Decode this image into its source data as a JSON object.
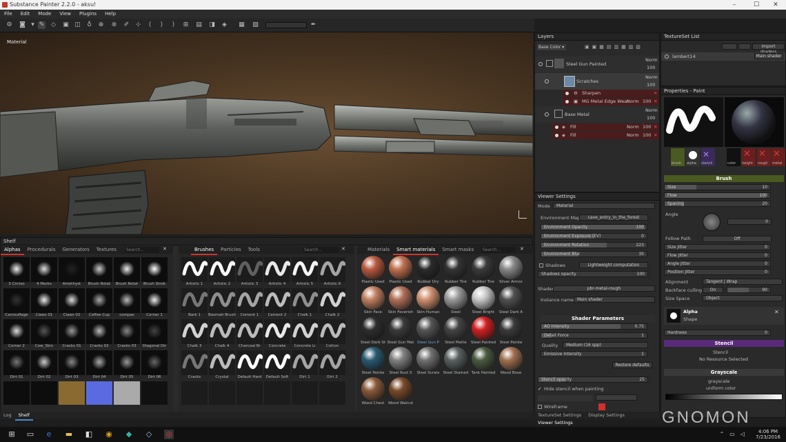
{
  "window": {
    "title": "Substance Painter 2.2.0 - aksu!"
  },
  "menu": [
    "File",
    "Edit",
    "Mode",
    "View",
    "Plugins",
    "Help"
  ],
  "viewport": {
    "label": "Material"
  },
  "layers": {
    "title": "Layers",
    "channel": "Base Color",
    "items": [
      {
        "name": "Steel Gun Painted",
        "blend": "Norm",
        "opacity": "100"
      },
      {
        "name": "Scratches",
        "blend": "Norm",
        "opacity": "100"
      },
      {
        "name": "Sharpen",
        "blend": "",
        "opacity": ""
      },
      {
        "name": "MG Metal Edge Wear",
        "blend": "Norm",
        "opacity": "100"
      },
      {
        "name": "Base Metal",
        "blend": "Norm",
        "opacity": "100"
      },
      {
        "name": "Fill",
        "blend": "Norm",
        "opacity": "100"
      },
      {
        "name": "Fill",
        "blend": "Norm",
        "opacity": "100"
      }
    ]
  },
  "textureset": {
    "title": "TextureSet List",
    "import_button": "Import shaders",
    "item": "lambert14",
    "shader": "Main shader"
  },
  "properties": {
    "title": "Properties - Paint",
    "slots": [
      "brush",
      "alpha",
      "stencil",
      "color",
      "height",
      "rough",
      "metal"
    ],
    "brush_section": "Brush",
    "size": {
      "label": "Size",
      "value": "10"
    },
    "flow": {
      "label": "Flow",
      "value": "100"
    },
    "spacing": {
      "label": "Spacing",
      "value": "20"
    },
    "angle": {
      "label": "Angle",
      "value": "0"
    },
    "follow_path": {
      "label": "Follow Path",
      "value": "Off"
    },
    "jitters": [
      {
        "label": "Size Jitter",
        "value": "0"
      },
      {
        "label": "Flow Jitter",
        "value": "0"
      },
      {
        "label": "Angle Jitter",
        "value": "0"
      },
      {
        "label": "Position Jitter",
        "value": "0"
      }
    ],
    "alignment": {
      "label": "Alignment",
      "value": "Tangent | Wrap"
    },
    "backface": {
      "label": "Backface culling",
      "toggle": "On",
      "value": "90"
    },
    "size_space": {
      "label": "Size Space",
      "value": "Object"
    },
    "alpha_section": "Alpha",
    "alpha_shape": "Shape",
    "hardness": {
      "label": "Hardness",
      "value": "0"
    },
    "stencil_section": "Stencil",
    "stencil_name": "Stencil",
    "stencil_status": "No Resource Selected",
    "grayscale_section": "Grayscale",
    "grayscale_name": "grayscale",
    "grayscale_sub": "uniform color"
  },
  "viewer": {
    "title": "Viewer Settings",
    "mode_label": "Mode",
    "mode": "Material",
    "envmap_label": "Environment Map",
    "envmap": "cave_entry_in_the_forest",
    "sliders": [
      {
        "label": "Environment Opacity",
        "value": "100",
        "fill": 0.98
      },
      {
        "label": "Environment Exposure (EV)",
        "value": "0",
        "fill": 0.5
      },
      {
        "label": "Environment Rotation",
        "value": "223",
        "fill": 0.62
      },
      {
        "label": "Environment Blur",
        "value": "35",
        "fill": 0.35
      }
    ],
    "shadows": "Shadows",
    "shadows_btn": "Lightweight computation",
    "shadows_opacity": {
      "label": "Shadows opacity",
      "value": "100"
    },
    "shader_label": "Shader",
    "shader": "pbr-metal-rough",
    "instance_label": "Instance name",
    "instance": "Main shader",
    "params_section": "Shader Parameters",
    "ao": {
      "label": "AO Intensity",
      "value": "0.75"
    },
    "face": {
      "label": "Detail Force",
      "value": "1"
    },
    "quality_label": "Quality",
    "quality": "Medium (16 spp)",
    "emissive": {
      "label": "Emissive Intensity",
      "value": "1"
    },
    "restore": "Restore defaults",
    "stencil_opacity": {
      "label": "Stencil opacity",
      "value": "25"
    },
    "hide_stencil": "Hide stencil when painting",
    "wireframe": "Wireframe",
    "bottom_tabs": [
      "TextureSet Settings",
      "Display Settings",
      "Viewer Settings"
    ]
  },
  "shelf": {
    "title": "Shelf",
    "tabs": [
      "Alphas",
      "Procedurals",
      "Generators",
      "Textures"
    ],
    "search": "Search...",
    "alphas": [
      "3 Circles",
      "4 Marks",
      "Amethyst",
      "Brush Rotat",
      "Brush Rotat",
      "Brush Strok",
      "Camouflage",
      "Claws 01",
      "Claws 02",
      "Coffee Cup",
      "compas",
      "Corner 1",
      "Corner 2",
      "Cow_Skin",
      "Cracks 01",
      "Cracks 02",
      "Cracks 03",
      "Diagonal Dir",
      "Dirt 01",
      "Dirt 02",
      "Dirt 03",
      "Dirt 04",
      "Dirt 05",
      "Dirt 06"
    ],
    "brush_tabs": [
      "Brushes",
      "Particles",
      "Tools"
    ],
    "brushes": [
      "Artistic 1",
      "Artistic 2",
      "Artistic 3",
      "Artistic 4",
      "Artistic 5",
      "Artistic 6",
      "Bark 1",
      "Basmati Brush",
      "Cement 1",
      "Cement 2",
      "Chalk 1",
      "Chalk 2",
      "Chalk 3",
      "Chalk 4",
      "Charcoal Br",
      "Concrete",
      "Concrete Li",
      "Cotton",
      "Cracks",
      "Crystal",
      "Default Hard",
      "Default Soft",
      "Dirt 1",
      "Dirt 2"
    ],
    "mat_tabs": [
      "Materials",
      "Smart materials",
      "Smart masks"
    ],
    "materials": [
      "Plastic Used",
      "Plastic Used",
      "Rubber Dry",
      "Rubber Tire",
      "Rubber Tire",
      "Silver Armor",
      "Skin Face",
      "Skin Feverish",
      "Skin Human",
      "Steel",
      "Steel Bright",
      "Steel Dark A",
      "Steel Dark St",
      "Steel Gun Mat",
      "Steel Gun P",
      "Steel Matte",
      "Steel Painted",
      "Steel Painte",
      "Steel Painte",
      "Steel Rust S",
      "Steel Scrats",
      "Steel Stained",
      "Tank Painted",
      "Wood Boxe",
      "Wood Chest",
      "Wood Walnut"
    ],
    "bottom_tabs": [
      "Log",
      "Shelf"
    ]
  },
  "branding": {
    "watermark": "GNOMON"
  },
  "taskbar": {
    "time": "4:06 PM",
    "date": "7/23/2016"
  },
  "colors": {
    "accent": "#d0362b",
    "stencil": "#7a3aa0",
    "brush": "#6a8a2a",
    "panel": "#2a2a2a"
  }
}
